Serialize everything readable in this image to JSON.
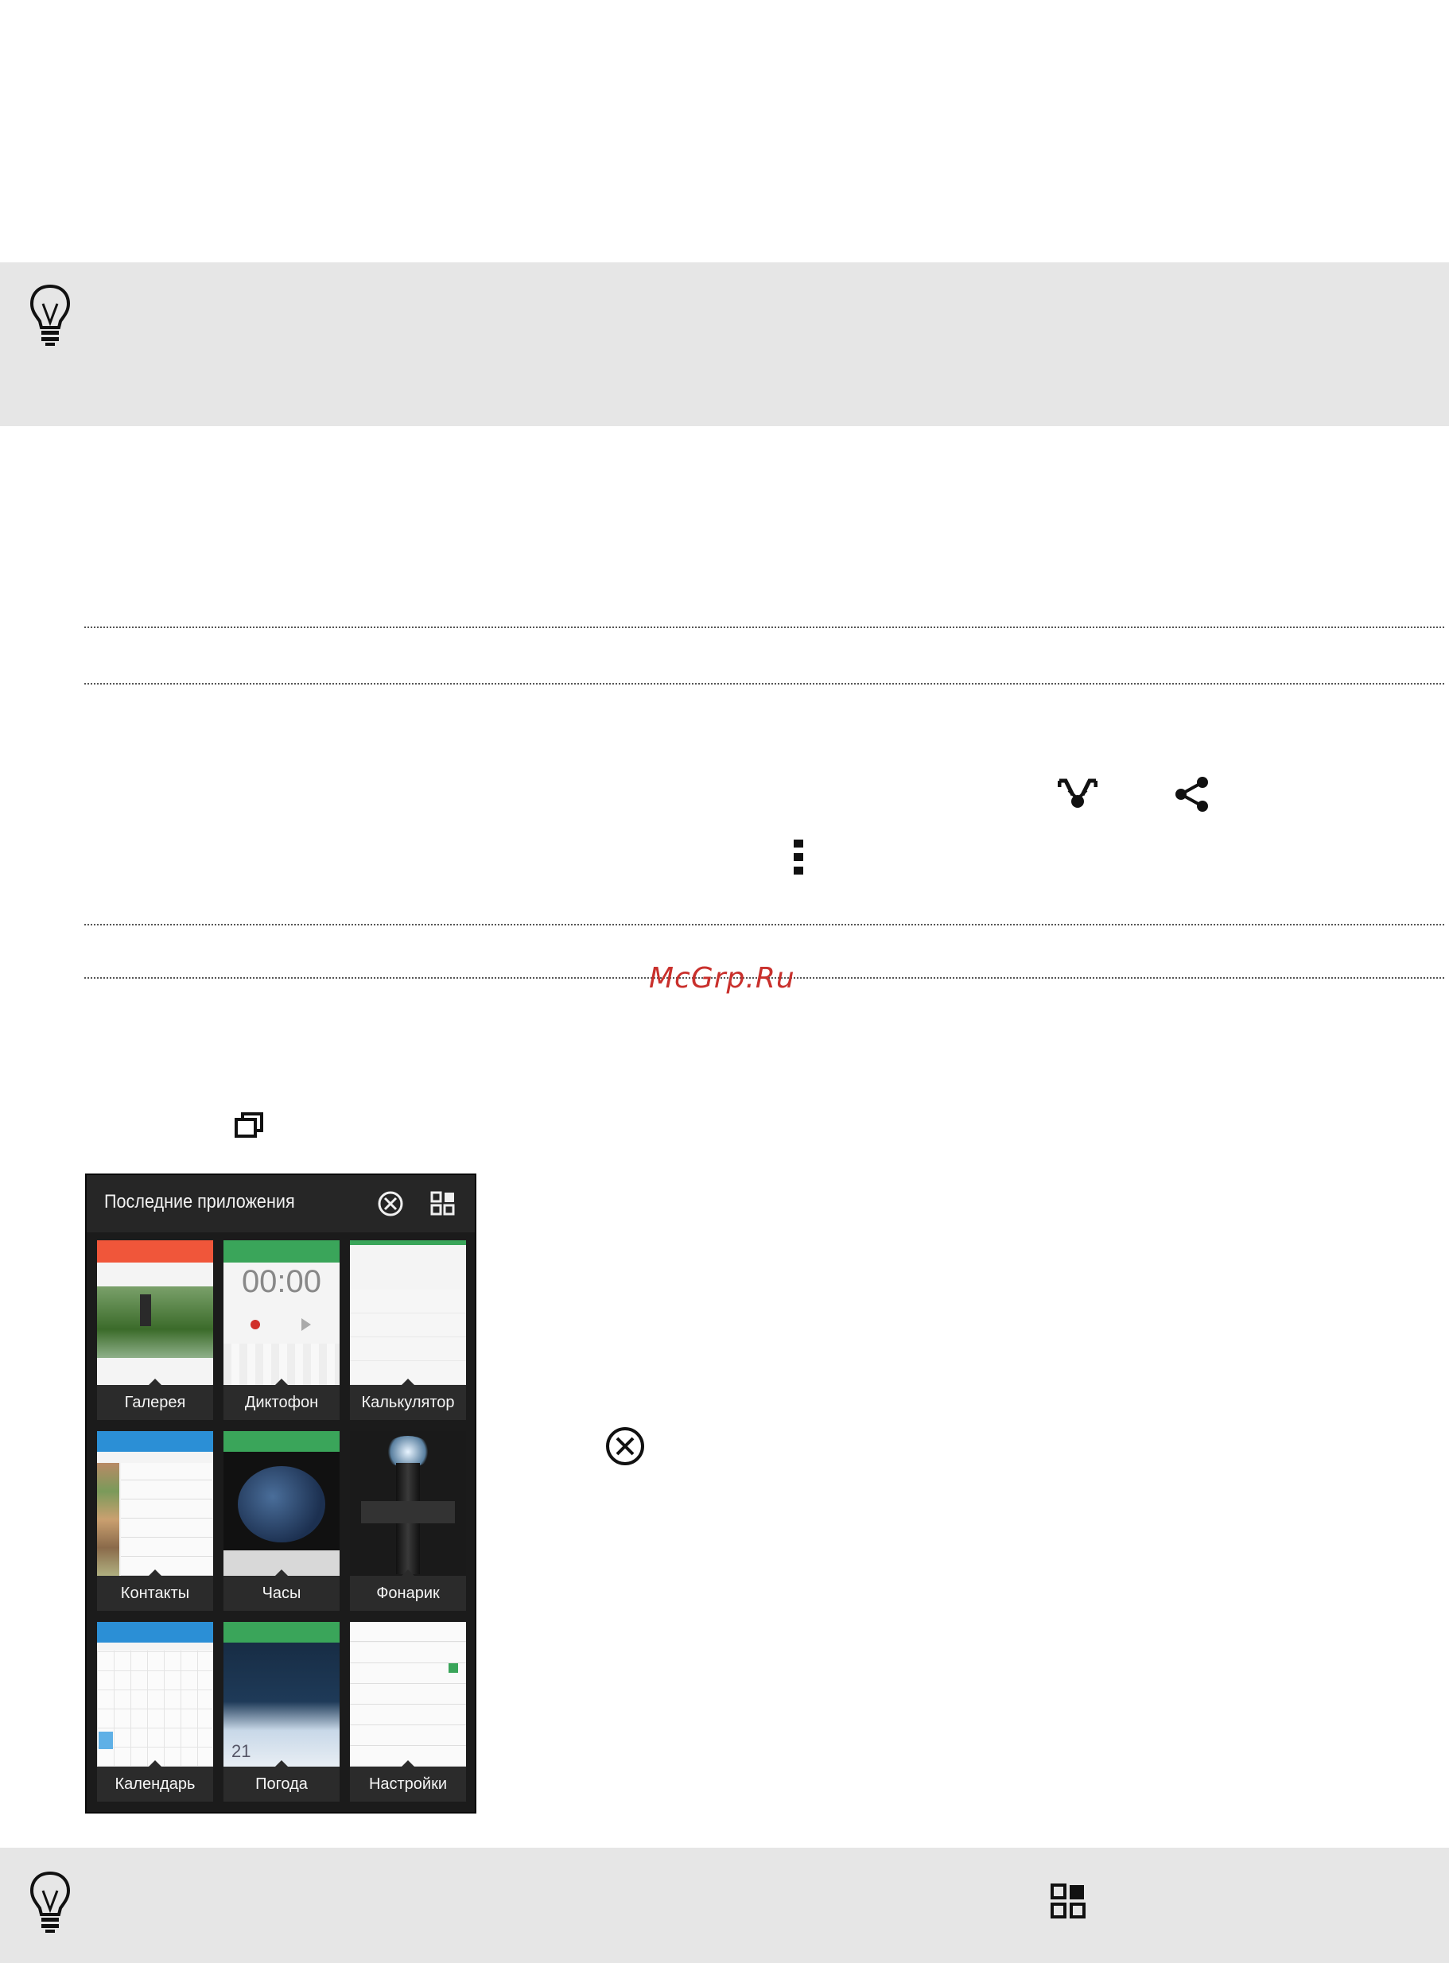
{
  "watermark": "McGrp.Ru",
  "recent_apps": {
    "title": "Последние приложения",
    "apps": [
      {
        "label": "Галерея"
      },
      {
        "label": "Диктофон",
        "timer": "00:00"
      },
      {
        "label": "Калькулятор"
      },
      {
        "label": "Контакты"
      },
      {
        "label": "Часы"
      },
      {
        "label": "Фонарик"
      },
      {
        "label": "Календарь"
      },
      {
        "label": "Погода",
        "temp": "21"
      },
      {
        "label": "Настройки"
      }
    ]
  },
  "colors": {
    "tip_band": "#e6e6e6",
    "watermark": "#c9302c",
    "gallery_header": "#f0563a",
    "green_header": "#3aa55a",
    "blue_header": "#2b8fd6"
  },
  "icons": [
    "lightbulb-icon",
    "beam-icon",
    "share-icon",
    "overflow-menu-icon",
    "recent-apps-icon",
    "close-all-icon",
    "grid-view-icon"
  ]
}
